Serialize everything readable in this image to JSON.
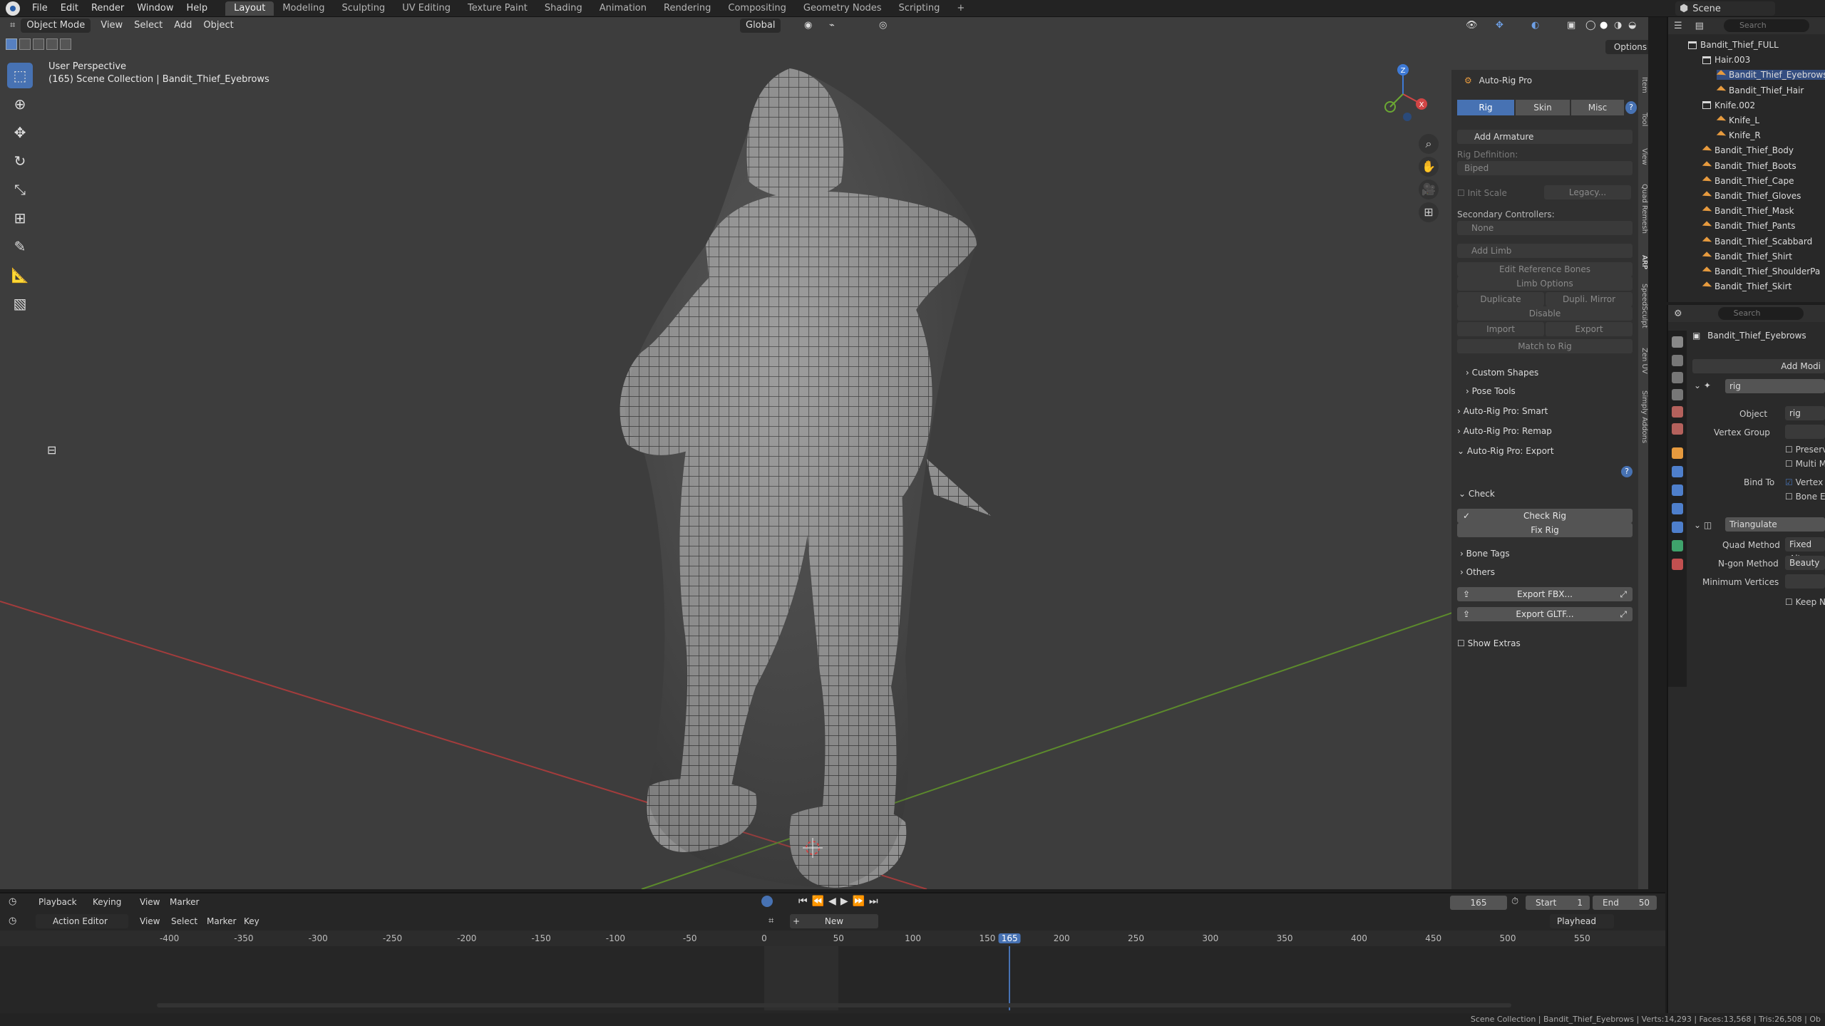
{
  "topbar": {
    "menus": [
      "File",
      "Edit",
      "Render",
      "Window",
      "Help"
    ],
    "workspaces": [
      "Layout",
      "Modeling",
      "Sculpting",
      "UV Editing",
      "Texture Paint",
      "Shading",
      "Animation",
      "Rendering",
      "Compositing",
      "Geometry Nodes",
      "Scripting"
    ],
    "active_workspace": "Layout",
    "add_tab": "+",
    "scene": "Scene"
  },
  "viewport": {
    "mode": "Object Mode",
    "menus": [
      "View",
      "Select",
      "Add",
      "Object"
    ],
    "orientation": "Global",
    "perspective_label": "User Perspective",
    "collection_label": "(165) Scene Collection | Bandit_Thief_Eyebrows",
    "options_label": "Options",
    "gizmo_axes": {
      "x": "X",
      "y": "Y",
      "z": "Z"
    }
  },
  "npanel": {
    "title": "Auto-Rig Pro",
    "tabs": [
      "Rig",
      "Skin",
      "Misc"
    ],
    "add_armature": "Add Armature",
    "rig_definition_label": "Rig Definition:",
    "rig_definition_value": "Biped",
    "init_scale": "Init Scale",
    "legacy": "Legacy...",
    "secondary_label": "Secondary Controllers:",
    "secondary_value": "None",
    "add_limb": "Add Limb",
    "edit_ref": "Edit Reference Bones",
    "limb_options": "Limb Options",
    "duplicate": "Duplicate",
    "dupli_mirror": "Dupli. Mirror",
    "disable": "Disable",
    "import": "Import",
    "export": "Export",
    "match_to_rig": "Match to Rig",
    "custom_shapes": "Custom Shapes",
    "pose_tools": "Pose Tools",
    "smart": "Auto-Rig Pro: Smart",
    "remap": "Auto-Rig Pro: Remap",
    "export_panel": "Auto-Rig Pro: Export",
    "check": "Check",
    "check_rig": "Check Rig",
    "fix_rig": "Fix Rig",
    "bone_tags": "Bone Tags",
    "others": "Others",
    "export_fbx": "Export FBX...",
    "export_gltf": "Export GLTF...",
    "show_extras": "Show Extras",
    "side_tabs": [
      "Item",
      "Tool",
      "View",
      "Quad Remesh",
      "ARP",
      "SpeedSculpt",
      "Zen UV",
      "Simply Addons"
    ]
  },
  "outliner": {
    "search_placeholder": "Search",
    "items": [
      {
        "label": "Bandit_Thief_FULL",
        "type": "collection",
        "depth": 1
      },
      {
        "label": "Hair.003",
        "type": "collection",
        "depth": 2
      },
      {
        "label": "Bandit_Thief_Eyebrows",
        "type": "mesh",
        "depth": 3
      },
      {
        "label": "Bandit_Thief_Hair",
        "type": "mesh",
        "depth": 3
      },
      {
        "label": "Knife.002",
        "type": "collection",
        "depth": 2
      },
      {
        "label": "Knife_L",
        "type": "mesh",
        "depth": 3
      },
      {
        "label": "Knife_R",
        "type": "mesh",
        "depth": 3
      },
      {
        "label": "Bandit_Thief_Body",
        "type": "mesh",
        "depth": 2
      },
      {
        "label": "Bandit_Thief_Boots",
        "type": "mesh",
        "depth": 2
      },
      {
        "label": "Bandit_Thief_Cape",
        "type": "mesh",
        "depth": 2
      },
      {
        "label": "Bandit_Thief_Gloves",
        "type": "mesh",
        "depth": 2
      },
      {
        "label": "Bandit_Thief_Mask",
        "type": "mesh",
        "depth": 2
      },
      {
        "label": "Bandit_Thief_Pants",
        "type": "mesh",
        "depth": 2
      },
      {
        "label": "Bandit_Thief_Scabbard",
        "type": "mesh",
        "depth": 2
      },
      {
        "label": "Bandit_Thief_Shirt",
        "type": "mesh",
        "depth": 2
      },
      {
        "label": "Bandit_Thief_ShoulderPa",
        "type": "mesh",
        "depth": 2
      },
      {
        "label": "Bandit_Thief_Skirt",
        "type": "mesh",
        "depth": 2
      }
    ]
  },
  "properties": {
    "search_placeholder": "Search",
    "object_name": "Bandit_Thief_Eyebrows",
    "add_modifier": "Add Modi",
    "mod1_name": "rig",
    "object_label": "Object",
    "object_value": "rig",
    "vgroup_label": "Vertex Group",
    "preserve": "Preserve",
    "multi": "Multi M",
    "bind_to": "Bind To",
    "vertex": "Vertex G",
    "bone_env": "Bone En",
    "mod2_name": "Triangulate",
    "quad_method_label": "Quad Method",
    "quad_method_value": "Fixed Alte",
    "ngon_label": "N-gon Method",
    "ngon_value": "Beauty",
    "min_vertices": "Minimum Vertices",
    "keep_normals": "Keep No"
  },
  "timeline": {
    "menus": [
      "Playback",
      "Keying",
      "View",
      "Marker"
    ],
    "current_frame": "165",
    "start_label": "Start",
    "start_value": "1",
    "end_label": "End",
    "end_value": "50"
  },
  "action_editor": {
    "mode": "Action Editor",
    "menus": [
      "View",
      "Select",
      "Marker",
      "Key"
    ],
    "new_button": "New",
    "playhead": "Playhead",
    "ticks": [
      "-400",
      "-350",
      "-300",
      "-250",
      "-200",
      "-150",
      "-100",
      "-50",
      "0",
      "50",
      "100",
      "150",
      "165",
      "200",
      "250",
      "300",
      "350",
      "400",
      "450",
      "500",
      "550"
    ],
    "current_frame": "165"
  },
  "statusbar": {
    "text": "Scene Collection | Bandit_Thief_Eyebrows | Verts:14,293 | Faces:13,568 | Tris:26,508 | Ob"
  },
  "colors": {
    "accent": "#4772b3",
    "viewport_bg": "#3d3d3d",
    "axis_x": "#c24a4a",
    "axis_y": "#6e9a35",
    "mesh_icon": "#e69a3e"
  }
}
